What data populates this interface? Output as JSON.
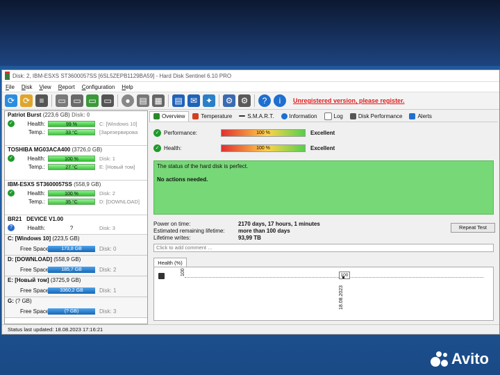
{
  "window": {
    "title": "Disk: 2, IBM-ESXS ST3600057SS [6SL5ZEPB1129BA59]  -  Hard Disk Sentinel 6.10 PRO"
  },
  "menu": [
    "File",
    "Disk",
    "View",
    "Report",
    "Configuration",
    "Help"
  ],
  "toolbar": {
    "unregistered": "Unregistered version, please register."
  },
  "disks": [
    {
      "name": "Patriot Burst",
      "size": "(223,6 GB)",
      "num": "Disk: 0",
      "health": "99 %",
      "health_extra": "C: [Windows 10]",
      "temp": "33 °C",
      "temp_extra": "[Зарезервирова"
    },
    {
      "name": "TOSHIBA MG03ACA400",
      "size": "(3726,0 GB)",
      "num": "",
      "health": "100 %",
      "health_extra": "Disk: 1",
      "temp": "27 °C",
      "temp_extra": "E: [Новый том]"
    },
    {
      "name": "IBM-ESXS ST3600057SS",
      "size": "(558,9 GB)",
      "num": "",
      "health": "100 %",
      "health_extra": "Disk: 2",
      "temp": "35 °C",
      "temp_extra": "D: [DOWNLOAD]"
    },
    {
      "name": "BR21",
      "size": "DEVICE V1.00",
      "num": "",
      "health": "?",
      "health_extra": "Disk: 3",
      "temp": "",
      "temp_extra": ""
    }
  ],
  "labels": {
    "health": "Health:",
    "temp": "Temp.:",
    "free_space": "Free Space"
  },
  "volumes": [
    {
      "name": "C: [Windows 10]",
      "size": "(223,5 GB)",
      "free": "173,8 GB",
      "disk": "Disk: 0"
    },
    {
      "name": "D: [DOWNLOAD]",
      "size": "(558,9 GB)",
      "free": "185,7 GB",
      "disk": "Disk: 2"
    },
    {
      "name": "E: [Новый том]",
      "size": "(3725,9 GB)",
      "free": "3360,2 GB",
      "disk": "Disk: 1"
    },
    {
      "name": "G:",
      "size": "(? GB)",
      "free": "(? GB)",
      "disk": "Disk: 3"
    }
  ],
  "tabs": [
    "Overview",
    "Temperature",
    "S.M.A.R.T.",
    "Information",
    "Log",
    "Disk Performance",
    "Alerts"
  ],
  "overview": {
    "performance_label": "Performance:",
    "performance_value": "100 %",
    "performance_text": "Excellent",
    "health_label": "Health:",
    "health_value": "100 %",
    "health_text": "Excellent",
    "status_line1": "The status of the hard disk is perfect.",
    "status_line2": "No actions needed."
  },
  "info": [
    {
      "label": "Power on time:",
      "value": "2170 days, 17 hours, 1 minutes"
    },
    {
      "label": "Estimated remaining lifetime:",
      "value": "more than 100 days"
    },
    {
      "label": "Lifetime writes:",
      "value": "93,99 TB"
    }
  ],
  "repeat_test": "Repeat Test",
  "comment_placeholder": "Click to add comment ...",
  "health_tab": "Health (%)",
  "chart_data": {
    "type": "line",
    "x": [
      "18.08.2023"
    ],
    "series": [
      {
        "values": [
          100
        ]
      }
    ],
    "y_tick": "100",
    "point_label": "100"
  },
  "statusbar": "Status last updated: 18.08.2023 17:16:21",
  "watermark": "Avito",
  "colors": {
    "accent_green": "#77d877",
    "unregistered_red": "#e01b1b",
    "free_space_blue": "#1867b6"
  }
}
